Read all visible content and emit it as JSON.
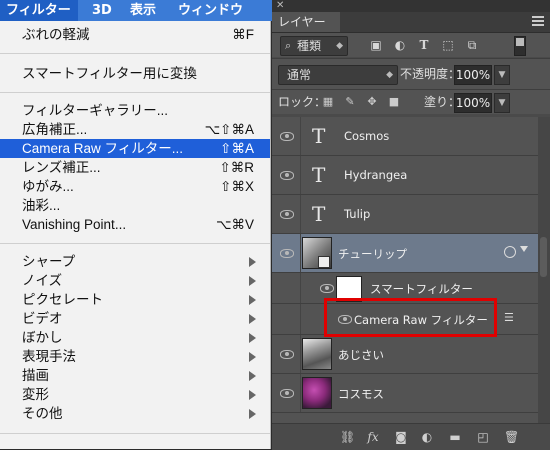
{
  "menubar": {
    "items": [
      {
        "label": "フィルター"
      },
      {
        "label": "3D"
      },
      {
        "label": "表示"
      },
      {
        "label": "ウィンドウ"
      }
    ]
  },
  "filter_menu": {
    "items": [
      {
        "label": "ぶれの軽減",
        "shortcut": "⌘F"
      },
      {
        "label": "スマートフィルター用に変換",
        "shortcut": ""
      },
      {
        "label": "フィルターギャラリー...",
        "shortcut": ""
      },
      {
        "label": "広角補正...",
        "shortcut": "⌥⇧⌘A"
      },
      {
        "label": "Camera Raw フィルター...",
        "shortcut": "⇧⌘A"
      },
      {
        "label": "レンズ補正...",
        "shortcut": "⇧⌘R"
      },
      {
        "label": "ゆがみ...",
        "shortcut": "⇧⌘X"
      },
      {
        "label": "油彩...",
        "shortcut": ""
      },
      {
        "label": "Vanishing Point...",
        "shortcut": "⌥⌘V"
      },
      {
        "label": "シャープ",
        "submenu": true
      },
      {
        "label": "ノイズ",
        "submenu": true
      },
      {
        "label": "ピクセレート",
        "submenu": true
      },
      {
        "label": "ビデオ",
        "submenu": true
      },
      {
        "label": "ぼかし",
        "submenu": true
      },
      {
        "label": "表現手法",
        "submenu": true
      },
      {
        "label": "描画",
        "submenu": true
      },
      {
        "label": "変形",
        "submenu": true
      },
      {
        "label": "その他",
        "submenu": true
      }
    ],
    "highlighted_index": 4
  },
  "layers_panel": {
    "tab_label": "レイヤー",
    "filter_kind": "種類",
    "blend_mode": "通常",
    "opacity_label": "不透明度：",
    "opacity_value": "100%",
    "lock_label": "ロック：",
    "fill_label": "塗り：",
    "fill_value": "100%",
    "layers": [
      {
        "name": "Cosmos",
        "type": "text"
      },
      {
        "name": "Hydrangea",
        "type": "text"
      },
      {
        "name": "Tulip",
        "type": "text"
      },
      {
        "name": "チューリップ",
        "type": "smart-object",
        "selected": true
      },
      {
        "name": "スマートフィルター",
        "type": "smart-filter-mask"
      },
      {
        "name": "Camera Raw フィルター",
        "type": "filter-effect",
        "highlighted": true
      },
      {
        "name": "あじさい",
        "type": "image"
      },
      {
        "name": "コスモス",
        "type": "image"
      }
    ]
  },
  "colors": {
    "menubar_bg": "#3b7bd6",
    "menu_highlight": "#1f5fd9",
    "panel_bg": "#535353",
    "selected_layer": "#6d7a8c",
    "annotation_red": "#e00000"
  }
}
